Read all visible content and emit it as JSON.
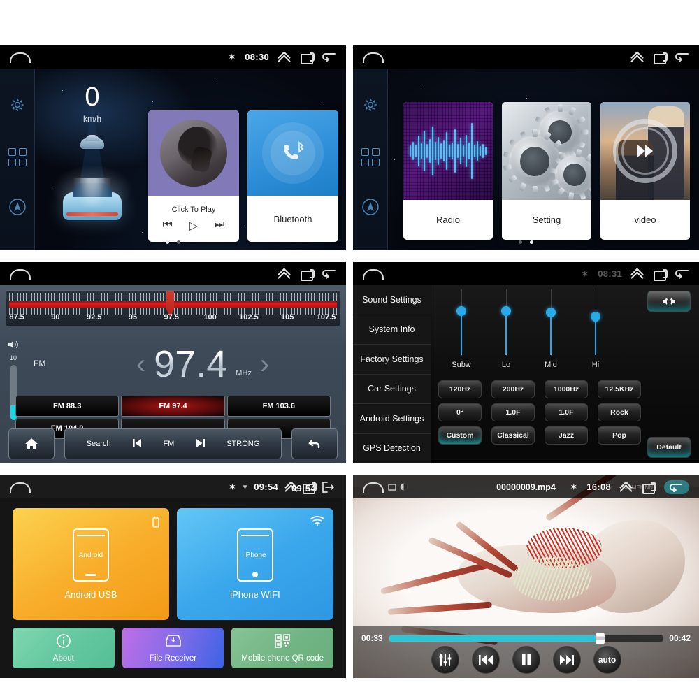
{
  "panels": {
    "home": {
      "name": "Home Screen",
      "statusbar": {
        "bluetooth": "✶",
        "clock": "08:30"
      },
      "rail": {
        "settings_icon": "gear-icon",
        "apps_icon": "apps-grid-icon",
        "nav_icon": "navigation-icon"
      },
      "speedometer": {
        "value": "0",
        "unit": "km/h"
      },
      "cards": [
        {
          "title": "Click To Play",
          "prev": "⏮",
          "play": "▷",
          "next": "⏭"
        },
        {
          "title": "Bluetooth"
        }
      ],
      "page_dots": [
        true,
        false
      ]
    },
    "apps": {
      "name": "App Drawer",
      "statusbar": {
        "clock": ""
      },
      "cards": [
        {
          "label": "Radio"
        },
        {
          "label": "Setting"
        },
        {
          "label": "video"
        }
      ],
      "page_dots": [
        false,
        true
      ]
    },
    "radio": {
      "name": "FM Radio",
      "statusbar": {
        "clock": ""
      },
      "dial": {
        "ticks": [
          "87.5",
          "90",
          "92.5",
          "95",
          "97.5",
          "100",
          "102.5",
          "105",
          "107.5"
        ],
        "min": 87.0,
        "max": 108.2,
        "needle": 97.4
      },
      "volume": {
        "label": "10",
        "level": 26
      },
      "band": "FM",
      "frequency": "97.4",
      "unit": "MHz",
      "prev_chevron": "‹",
      "next_chevron": "›",
      "presets": [
        {
          "label": "FM 88.3",
          "active": false
        },
        {
          "label": "FM 97.4",
          "active": true
        },
        {
          "label": "FM 103.6",
          "active": false
        },
        {
          "label": "FM 104.0",
          "active": false
        },
        {
          "label": "",
          "active": false
        },
        {
          "label": "",
          "active": false
        }
      ],
      "toolbar": {
        "home": "home-icon",
        "search": "Search",
        "prev": "⏴",
        "band": "FM",
        "next": "⏵",
        "strength": "STRONG",
        "back": "back-icon"
      }
    },
    "sound": {
      "name": "Sound Settings",
      "statusbar": {
        "bluetooth": "✶",
        "clock": "08:31"
      },
      "menu": [
        "Sound Settings",
        "System Info",
        "Factory Settings",
        "Car Settings",
        "Android Settings",
        "GPS Detection"
      ],
      "sliders": [
        {
          "label": "Subw",
          "pos": 26
        },
        {
          "label": "Lo",
          "pos": 26
        },
        {
          "label": "Mid",
          "pos": 28
        },
        {
          "label": "Hi",
          "pos": 34
        }
      ],
      "speaker_button": "speaker-balance-icon",
      "buttons": [
        {
          "label": "120Hz",
          "on": false
        },
        {
          "label": "200Hz",
          "on": false
        },
        {
          "label": "1000Hz",
          "on": false
        },
        {
          "label": "12.5KHz",
          "on": false
        },
        {
          "label": "0°",
          "on": false
        },
        {
          "label": "1.0F",
          "on": false
        },
        {
          "label": "1.0F",
          "on": false
        },
        {
          "label": "Rock",
          "on": false
        },
        {
          "label": "Custom",
          "on": true
        },
        {
          "label": "Classical",
          "on": false
        },
        {
          "label": "Jazz",
          "on": false
        },
        {
          "label": "Pop",
          "on": false
        }
      ],
      "default_button": "Default"
    },
    "mirror": {
      "name": "Mirror Link",
      "statusbar": {
        "bluetooth": "✶",
        "wifi": "▾",
        "clock": "09:54",
        "clock_overlay": "09:54"
      },
      "tiles": [
        {
          "label": "Android USB",
          "screen_text": "Android",
          "corner_icon": "usb-icon"
        },
        {
          "label": "iPhone WIFI",
          "screen_text": "iPhone",
          "corner_icon": "wifi-icon"
        }
      ],
      "buttons": [
        {
          "label": "About",
          "icon": "info-icon"
        },
        {
          "label": "File Receiver",
          "icon": "download-tray-icon"
        },
        {
          "label": "Mobile phone QR code",
          "icon": "qr-code-icon"
        }
      ]
    },
    "video": {
      "name": "Video Player",
      "statusbar": {
        "filename": "00000009.mp4",
        "bluetooth": "✶",
        "clock": "16:08"
      },
      "watermark": "CHIMEI INN",
      "seek": {
        "current": "00:33",
        "total": "00:42",
        "percent": 77
      },
      "controls": [
        {
          "name": "equalizer-button",
          "glyph": "⚕"
        },
        {
          "name": "previous-button",
          "glyph": "⏮"
        },
        {
          "name": "pause-button",
          "glyph": "⏸"
        },
        {
          "name": "next-button",
          "glyph": "⏭"
        },
        {
          "name": "auto-button",
          "glyph": "auto"
        }
      ]
    }
  },
  "colors": {
    "accent_blue": "#29a9e8",
    "accent_cyan": "#2ec6d4",
    "radio_red": "#e01a1a",
    "android_orange": "#f8ae2b",
    "iphone_blue": "#3aa7ec"
  }
}
